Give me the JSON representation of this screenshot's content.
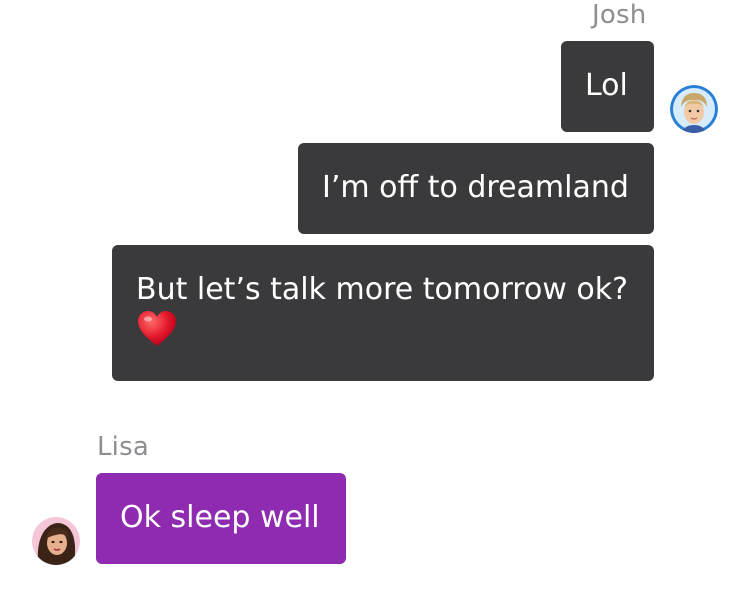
{
  "conversation": {
    "outgoing": {
      "sender": "Josh",
      "messages": [
        {
          "text": "Lol"
        },
        {
          "text": "I’m off to dreamland"
        },
        {
          "text": "But let’s talk more tomorrow ok?",
          "emoji": "heart-emoji"
        }
      ],
      "avatar": "josh-avatar",
      "bubble_color": "#3a3a3c"
    },
    "incoming": {
      "sender": "Lisa",
      "messages": [
        {
          "text": "Ok sleep well"
        }
      ],
      "avatar": "lisa-avatar",
      "bubble_color": "#8e2bb0"
    },
    "name_color": "#8e8e93"
  }
}
